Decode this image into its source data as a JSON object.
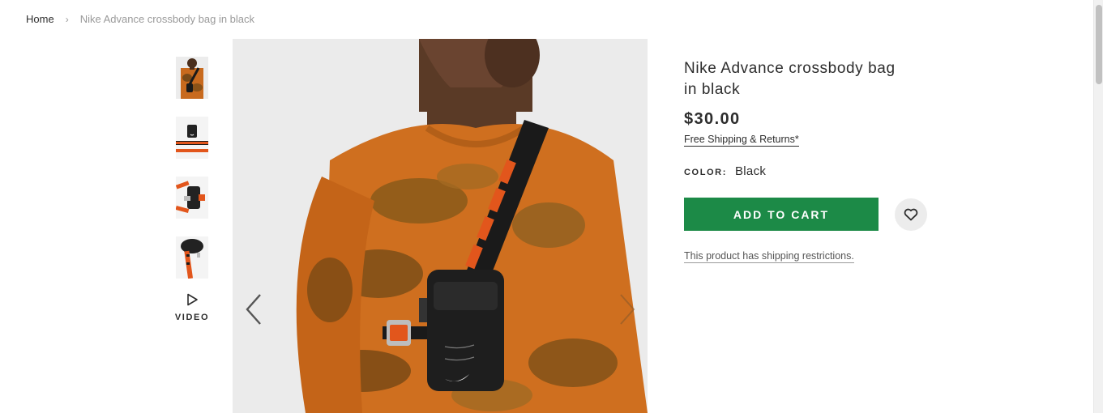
{
  "breadcrumb": {
    "home": "Home",
    "separator": "›",
    "current": "Nike Advance crossbody bag in black"
  },
  "gallery": {
    "thumbnails": [
      {
        "alt": "Model front view in orange tie-dye top"
      },
      {
        "alt": "Bag with strap flat"
      },
      {
        "alt": "Bag back view with buckle"
      },
      {
        "alt": "Bag top view with strap"
      }
    ],
    "video_label": "VIDEO",
    "prev_icon": "chevron-left-icon",
    "next_icon": "chevron-right-icon"
  },
  "product": {
    "title": "Nike Advance crossbody bag in black",
    "price": "$30.00",
    "shipping_link": "Free Shipping & Returns*",
    "color_label": "COLOR:",
    "color_value": "Black",
    "add_to_cart": "ADD TO CART",
    "wishlist_icon": "heart-icon",
    "restrictions": "This product has shipping restrictions."
  },
  "colors": {
    "accent_green": "#1c8a47",
    "text": "#2d2d2d",
    "muted": "#9a9a9a"
  }
}
